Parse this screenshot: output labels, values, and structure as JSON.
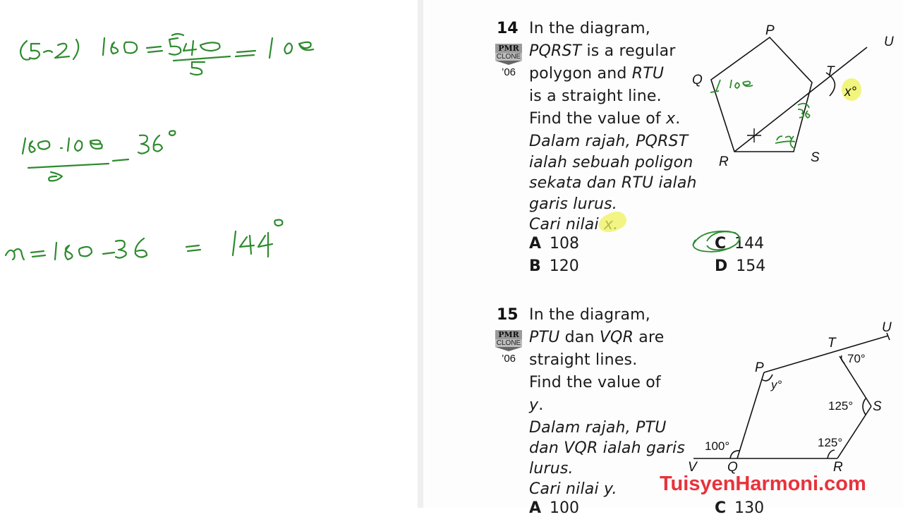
{
  "whiteboard": {
    "ink_color": "#2e8b2e",
    "lines": [
      "(5−2)180 = 540/5 = 108",
      "(180−108)/2 = 36°",
      "x = 180 − 36 = 144°"
    ]
  },
  "questions": [
    {
      "number": "14",
      "badge": {
        "top": "PMR",
        "middle": "CLONE",
        "year": "’06"
      },
      "english_lines": [
        {
          "parts": [
            {
              "t": "In the diagram,",
              "i": false
            }
          ]
        },
        {
          "parts": [
            {
              "t": "PQRST",
              "i": true
            },
            {
              "t": " is a regular",
              "i": false
            }
          ]
        },
        {
          "parts": [
            {
              "t": "polygon and ",
              "i": false
            },
            {
              "t": "RTU",
              "i": true
            }
          ]
        },
        {
          "parts": [
            {
              "t": "is a straight line.",
              "i": false
            }
          ]
        },
        {
          "parts": [
            {
              "t": "Find the value of ",
              "i": false
            },
            {
              "t": "x",
              "i": true
            },
            {
              "t": ".",
              "i": false
            }
          ]
        }
      ],
      "malay_lines": [
        "Dalam rajah, PQRST",
        "ialah sebuah poligon",
        "sekata dan RTU ialah",
        "garis lurus.",
        "Cari nilai x."
      ],
      "options": [
        {
          "letter": "A",
          "value": "108"
        },
        {
          "letter": "B",
          "value": "120"
        },
        {
          "letter": "C",
          "value": "144",
          "circled": true
        },
        {
          "letter": "D",
          "value": "154"
        }
      ],
      "diagram": {
        "vertex_labels": [
          "P",
          "Q",
          "R",
          "S",
          "T",
          "U"
        ],
        "angle_label": "x°",
        "annotations": [
          "108",
          "36",
          "108"
        ]
      }
    },
    {
      "number": "15",
      "badge": {
        "top": "PMR",
        "middle": "CLONE",
        "year": "’06"
      },
      "english_lines": [
        {
          "parts": [
            {
              "t": "In the diagram,",
              "i": false
            }
          ]
        },
        {
          "parts": [
            {
              "t": "PTU",
              "i": true
            },
            {
              "t": " dan ",
              "i": false
            },
            {
              "t": "VQR",
              "i": true
            },
            {
              "t": " are",
              "i": false
            }
          ]
        },
        {
          "parts": [
            {
              "t": "straight lines.",
              "i": false
            }
          ]
        },
        {
          "parts": [
            {
              "t": "Find the value of",
              "i": false
            }
          ]
        },
        {
          "parts": [
            {
              "t": "y",
              "i": true
            },
            {
              "t": ".",
              "i": false
            }
          ]
        }
      ],
      "malay_lines": [
        "Dalam rajah, PTU",
        "dan VQR ialah garis",
        "lurus.",
        "Cari nilai y."
      ],
      "options": [
        {
          "letter": "A",
          "value": "100"
        },
        {
          "letter": "C",
          "value": "130"
        }
      ],
      "diagram": {
        "vertex_labels": [
          "P",
          "Q",
          "R",
          "S",
          "T",
          "U",
          "V"
        ],
        "angles": {
          "T": "70°",
          "P": "y°",
          "S": "125°",
          "R": "125°",
          "Q": "100°"
        }
      }
    }
  ],
  "watermark": {
    "text": "TuisyenHarmoni.com",
    "color": "#e8323c"
  },
  "highlight_color": "#eef25a"
}
